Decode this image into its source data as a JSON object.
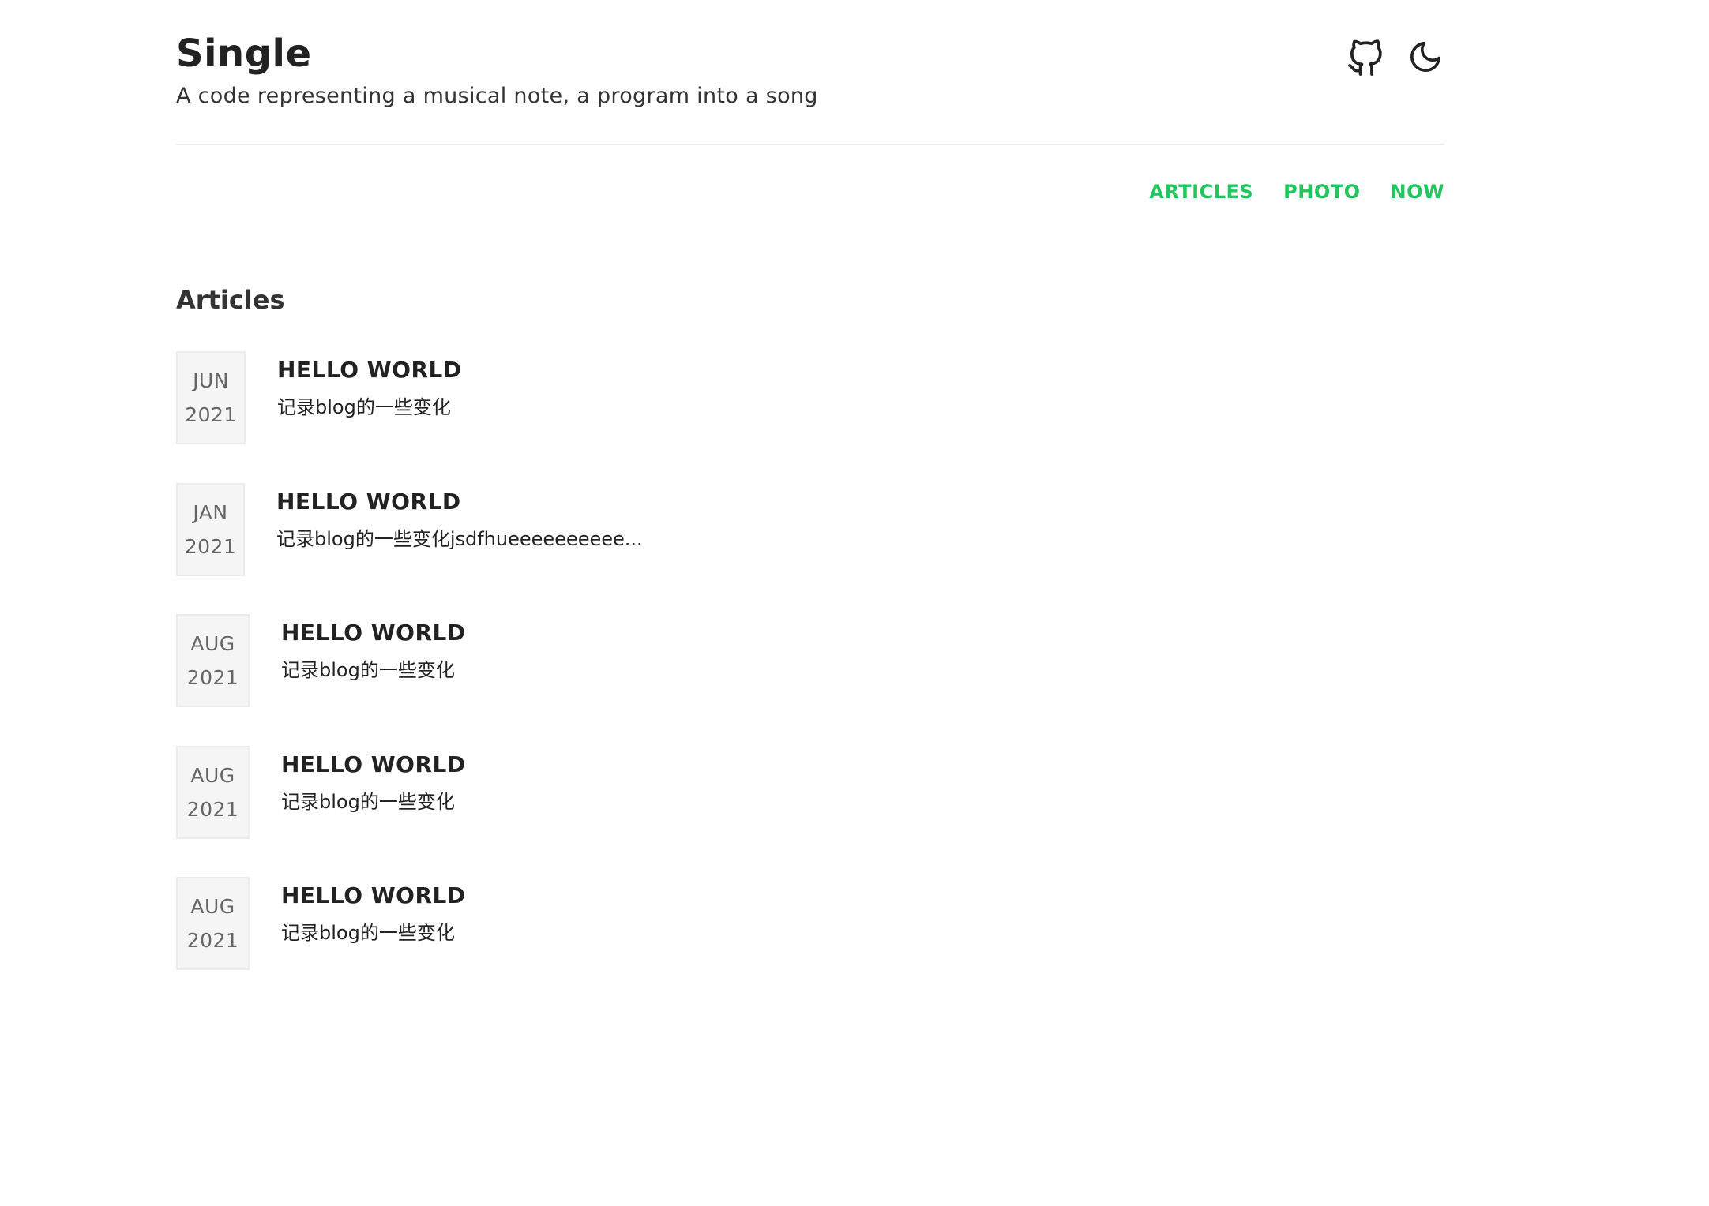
{
  "header": {
    "title": "Single",
    "subtitle": "A code representing a musical note, a program into a song",
    "icons": [
      "github-icon",
      "moon-icon"
    ]
  },
  "nav": {
    "items": [
      {
        "label": "ARTICLES"
      },
      {
        "label": "PHOTO"
      },
      {
        "label": "NOW"
      }
    ],
    "accent_color": "#22c55e"
  },
  "section": {
    "title": "Articles"
  },
  "posts": [
    {
      "month": "JUN",
      "year": "2021",
      "title": "HELLO WORLD",
      "summary": "记录blog的一些变化"
    },
    {
      "month": "JAN",
      "year": "2021",
      "title": "HELLO WORLD",
      "summary": "记录blog的一些变化jsdfhueeeeeeeeee..."
    },
    {
      "month": "AUG",
      "year": "2021",
      "title": "HELLO WORLD",
      "summary": "记录blog的一些变化"
    },
    {
      "month": "AUG",
      "year": "2021",
      "title": "HELLO WORLD",
      "summary": "记录blog的一些变化"
    },
    {
      "month": "AUG",
      "year": "2021",
      "title": "HELLO WORLD",
      "summary": "记录blog的一些变化"
    }
  ]
}
